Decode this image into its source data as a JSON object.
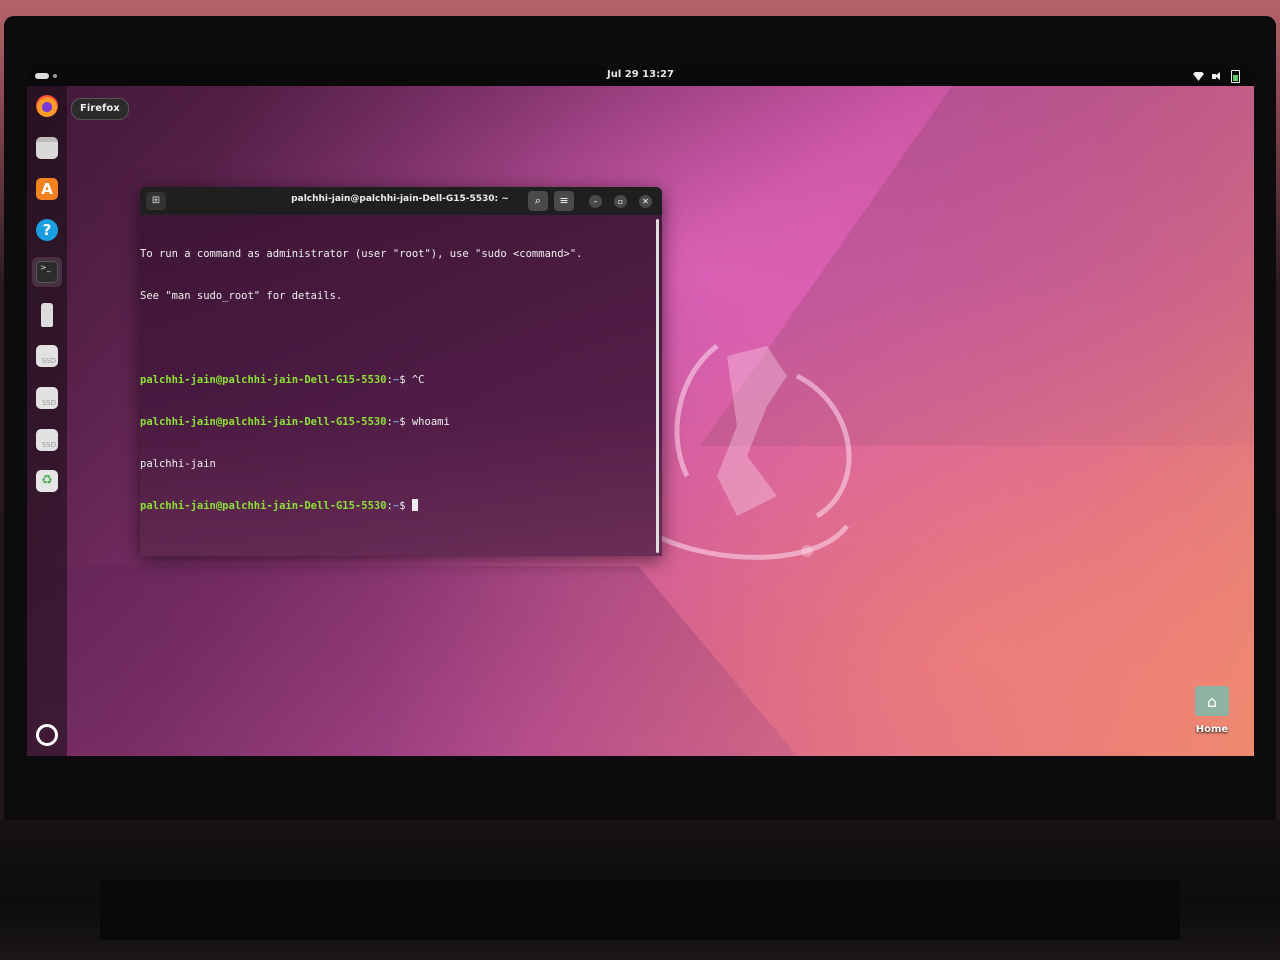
{
  "topbar": {
    "clock": "Jul 29  13:27",
    "icons": [
      "activities-icon",
      "wifi-icon",
      "volume-icon",
      "battery-icon"
    ]
  },
  "dock": {
    "tooltip": "Firefox",
    "items": [
      {
        "name": "firefox",
        "icon": "firefox-icon"
      },
      {
        "name": "files",
        "icon": "files-icon"
      },
      {
        "name": "app-center",
        "icon": "app-center-icon",
        "glyph": "A"
      },
      {
        "name": "help",
        "icon": "help-icon",
        "glyph": "?"
      },
      {
        "name": "terminal",
        "icon": "terminal-icon",
        "glyph": ">_",
        "active": true
      },
      {
        "name": "usb-drive",
        "icon": "usb-drive-icon"
      },
      {
        "name": "drive-1",
        "icon": "drive-icon",
        "glyph": "SSD"
      },
      {
        "name": "drive-2",
        "icon": "drive-icon",
        "glyph": "SSD"
      },
      {
        "name": "drive-3",
        "icon": "drive-icon",
        "glyph": "SSD"
      },
      {
        "name": "trash",
        "icon": "trash-icon",
        "glyph": "♻"
      },
      {
        "name": "show-apps",
        "icon": "app-grid-icon"
      }
    ]
  },
  "terminal": {
    "title": "palchhi-jain@palchhi-jain-Dell-G15-5530: ~",
    "lines": [
      {
        "text": "To run a command as administrator (user \"root\"), use \"sudo <command>\"."
      },
      {
        "text": "See \"man sudo_root\" for details."
      },
      {
        "text": ""
      },
      {
        "prompt": "palchhi-jain@palchhi-jain-Dell-G15-5530",
        "path": "~",
        "cmd": "^C"
      },
      {
        "prompt": "palchhi-jain@palchhi-jain-Dell-G15-5530",
        "path": "~",
        "cmd": "whoami"
      },
      {
        "text": "palchhi-jain"
      },
      {
        "prompt": "palchhi-jain@palchhi-jain-Dell-G15-5530",
        "path": "~",
        "cmd": "",
        "cursor": true
      }
    ]
  },
  "desktop": {
    "home_label": "Home"
  },
  "colors": {
    "prompt": "#8ae234",
    "path": "#729fcf",
    "topbar": "#0b0a0b"
  }
}
